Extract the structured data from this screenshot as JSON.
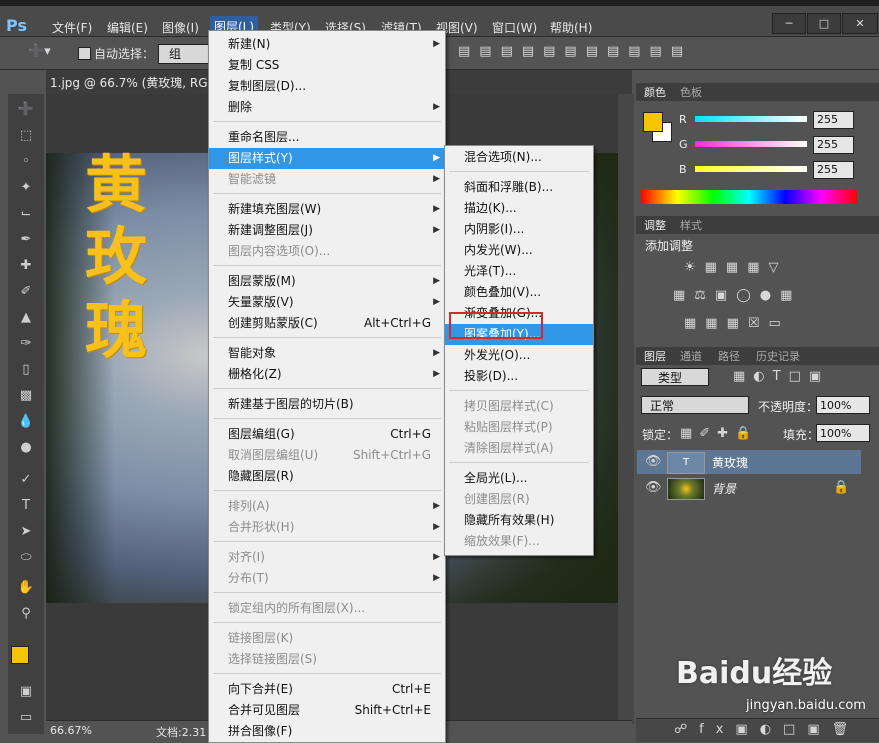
{
  "app": {
    "logo": "Ps"
  },
  "menubar": [
    {
      "label": "文件(F)"
    },
    {
      "label": "编辑(E)"
    },
    {
      "label": "图像(I)"
    },
    {
      "label": "图层(L)"
    },
    {
      "label": "类型(Y)"
    },
    {
      "label": "选择(S)"
    },
    {
      "label": "滤镜(T)"
    },
    {
      "label": "视图(V)"
    },
    {
      "label": "窗口(W)"
    },
    {
      "label": "帮助(H)"
    }
  ],
  "options_bar": {
    "auto_select_label": "自动选择：",
    "auto_select_value": "组"
  },
  "document": {
    "tab_title": "1.jpg @ 66.7% (黄玫瑰, RGB",
    "canvas_text": [
      "黄",
      "玫",
      "瑰"
    ],
    "zoom": "66.67%",
    "doc_size_label": "文档:2.31"
  },
  "layer_menu": {
    "items": [
      {
        "label": "新建(N)",
        "submenu": true
      },
      {
        "label": "复制 CSS"
      },
      {
        "label": "复制图层(D)..."
      },
      {
        "label": "删除",
        "submenu": true
      },
      {
        "label": "重命名图层..."
      },
      {
        "label": "图层样式(Y)",
        "submenu": true,
        "highlighted": true
      },
      {
        "label": "智能滤镜",
        "disabled": true,
        "submenu": true
      },
      {
        "label": "新建填充图层(W)",
        "submenu": true
      },
      {
        "label": "新建调整图层(J)",
        "submenu": true
      },
      {
        "label": "图层内容选项(O)...",
        "disabled": true
      },
      {
        "label": "图层蒙版(M)",
        "submenu": true
      },
      {
        "label": "矢量蒙版(V)",
        "submenu": true
      },
      {
        "label": "创建剪贴蒙版(C)",
        "shortcut": "Alt+Ctrl+G"
      },
      {
        "label": "智能对象",
        "submenu": true
      },
      {
        "label": "栅格化(Z)",
        "submenu": true
      },
      {
        "label": "新建基于图层的切片(B)"
      },
      {
        "label": "图层编组(G)",
        "shortcut": "Ctrl+G"
      },
      {
        "label": "取消图层编组(U)",
        "shortcut": "Shift+Ctrl+G",
        "disabled": true
      },
      {
        "label": "隐藏图层(R)"
      },
      {
        "label": "排列(A)",
        "disabled": true,
        "submenu": true
      },
      {
        "label": "合并形状(H)",
        "disabled": true,
        "submenu": true
      },
      {
        "label": "对齐(I)",
        "disabled": true,
        "submenu": true
      },
      {
        "label": "分布(T)",
        "disabled": true,
        "submenu": true
      },
      {
        "label": "锁定组内的所有图层(X)...",
        "disabled": true
      },
      {
        "label": "链接图层(K)",
        "disabled": true
      },
      {
        "label": "选择链接图层(S)",
        "disabled": true
      },
      {
        "label": "向下合并(E)",
        "shortcut": "Ctrl+E"
      },
      {
        "label": "合并可见图层",
        "shortcut": "Shift+Ctrl+E"
      },
      {
        "label": "拼合图像(F)"
      }
    ]
  },
  "style_submenu": {
    "items": [
      {
        "label": "混合选项(N)..."
      },
      {
        "label": "斜面和浮雕(B)..."
      },
      {
        "label": "描边(K)..."
      },
      {
        "label": "内阴影(I)..."
      },
      {
        "label": "内发光(W)..."
      },
      {
        "label": "光泽(T)..."
      },
      {
        "label": "颜色叠加(V)..."
      },
      {
        "label": "渐变叠加(G)..."
      },
      {
        "label": "图案叠加(Y)...",
        "highlighted": true
      },
      {
        "label": "外发光(O)..."
      },
      {
        "label": "投影(D)..."
      },
      {
        "label": "拷贝图层样式(C)",
        "disabled": true
      },
      {
        "label": "粘贴图层样式(P)",
        "disabled": true
      },
      {
        "label": "清除图层样式(A)",
        "disabled": true
      },
      {
        "label": "全局光(L)..."
      },
      {
        "label": "创建图层(R)",
        "disabled": true
      },
      {
        "label": "隐藏所有效果(H)"
      },
      {
        "label": "缩放效果(F)...",
        "disabled": true
      }
    ]
  },
  "color_panel": {
    "tabs": [
      "颜色",
      "色板"
    ],
    "channels": [
      {
        "name": "R",
        "value": "255",
        "color": "#00e5ff"
      },
      {
        "name": "G",
        "value": "255",
        "color": "#ff2ad4"
      },
      {
        "name": "B",
        "value": "255",
        "color": "#ffff26"
      }
    ],
    "foreground": "#f7c400",
    "background": "#ffffff"
  },
  "adjust_panel": {
    "tabs": [
      "调整",
      "样式"
    ],
    "title": "添加调整"
  },
  "layers_panel": {
    "tabs": [
      "图层",
      "通道",
      "路径",
      "历史记录"
    ],
    "filter_label": "类型",
    "blend_mode": "正常",
    "opacity_label": "不透明度：",
    "opacity_value": "100%",
    "lock_label": "锁定：",
    "fill_label": "填充：",
    "fill_value": "100%",
    "layers": [
      {
        "name": "黄玫瑰",
        "selected": true
      },
      {
        "name": "背景",
        "locked": true
      }
    ]
  },
  "watermark": {
    "text": "Baidu经验",
    "url": "jingyan.baidu.com"
  },
  "accent_colors": {
    "menu_highlight": "#3296e6",
    "red_box": "#d8282e",
    "canvas_text": "#f7c01a"
  }
}
